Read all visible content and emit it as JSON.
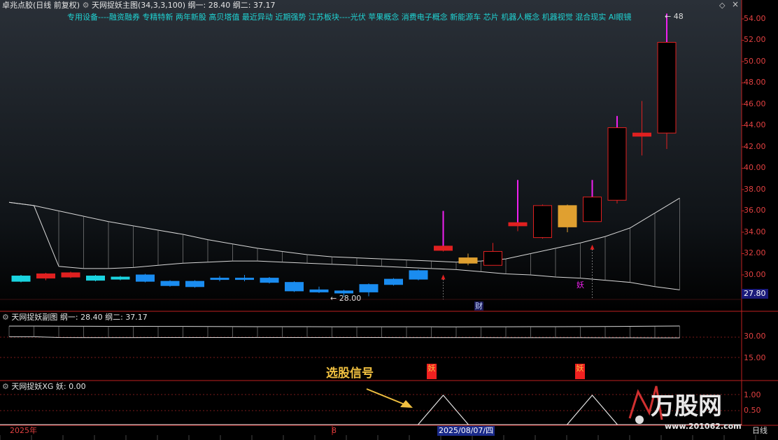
{
  "header": {
    "stock": "卓兆点胶(日线 前复权)",
    "main_indicator": "天网捉妖主图(34,3,3,100)",
    "gang1_label": "纲一:",
    "gang1_value": "28.40",
    "gang2_label": "纲二:",
    "gang2_value": "37.17"
  },
  "concept_tags": "专用设备----融资融券 专精特新 两年新股 高贝塔值 最近异动 近期强势 江苏板块----光伏 苹果概念 消费电子概念 新能源车 芯片 机器人概念 机器视觉 混合现实 AI眼镜",
  "sub1": {
    "title": "天网捉妖副图",
    "gang1_label": "纲一:",
    "gang1_value": "28.40",
    "gang2_label": "纲二:",
    "gang2_value": "37.17"
  },
  "sub2": {
    "title": "天网捉妖XG",
    "yao_label": "妖:",
    "yao_value": "0.00"
  },
  "annotations": {
    "signal_text": "选股信号",
    "low_price": "28.00",
    "high_price": "48",
    "cai": "财",
    "yao_char": "妖",
    "flag1": "妖",
    "flag2": "妖"
  },
  "price_axis": [
    "54.00",
    "52.00",
    "50.00",
    "48.00",
    "46.00",
    "44.00",
    "42.00",
    "40.00",
    "38.00",
    "36.00",
    "34.00",
    "32.00",
    "30.00"
  ],
  "current_price": "27.80",
  "sub1_axis": [
    "30.00",
    "15.00"
  ],
  "sub2_axis": [
    "1.00",
    "0.50"
  ],
  "bottom_bar": {
    "year": "2025年",
    "month": "8",
    "date": "2025/08/07/四",
    "period": "日线"
  },
  "watermark": {
    "brand": "万股网",
    "url": "www.201062.com"
  },
  "colors": {
    "up": "#e02020",
    "down_cyan": "#1ad4e0",
    "down_blue": "#1a8cf0",
    "gold": "#e0a030",
    "magenta": "#f020f0",
    "axis": "#c02020"
  },
  "chart_data": {
    "type": "candlestick",
    "candles": [
      {
        "o": 29.9,
        "c": 29.4,
        "h": 30.0,
        "l": 29.3,
        "color": "cyan"
      },
      {
        "o": 29.7,
        "c": 30.1,
        "h": 30.2,
        "l": 29.5,
        "color": "up"
      },
      {
        "o": 29.8,
        "c": 30.2,
        "h": 30.3,
        "l": 29.7,
        "color": "up"
      },
      {
        "o": 29.9,
        "c": 29.5,
        "h": 30.0,
        "l": 29.4,
        "color": "cyan"
      },
      {
        "o": 29.8,
        "c": 29.6,
        "h": 29.9,
        "l": 29.5,
        "color": "cyan_doji"
      },
      {
        "o": 30.0,
        "c": 29.4,
        "h": 30.1,
        "l": 29.3,
        "color": "blue"
      },
      {
        "o": 29.4,
        "c": 29.0,
        "h": 29.5,
        "l": 28.9,
        "color": "blue"
      },
      {
        "o": 29.4,
        "c": 28.9,
        "h": 29.5,
        "l": 28.8,
        "color": "blue"
      },
      {
        "o": 29.7,
        "c": 29.6,
        "h": 29.9,
        "l": 29.4,
        "color": "blue_doji"
      },
      {
        "o": 29.7,
        "c": 29.6,
        "h": 30.0,
        "l": 29.4,
        "color": "blue_doji"
      },
      {
        "o": 29.7,
        "c": 29.3,
        "h": 29.8,
        "l": 29.2,
        "color": "blue"
      },
      {
        "o": 29.3,
        "c": 28.5,
        "h": 29.4,
        "l": 28.4,
        "color": "blue"
      },
      {
        "o": 28.6,
        "c": 28.4,
        "h": 28.9,
        "l": 28.3,
        "color": "blue"
      },
      {
        "o": 28.5,
        "c": 28.3,
        "h": 28.6,
        "l": 28.0,
        "color": "blue"
      },
      {
        "o": 29.1,
        "c": 28.4,
        "h": 29.2,
        "l": 28.0,
        "color": "blue"
      },
      {
        "o": 29.6,
        "c": 29.1,
        "h": 29.7,
        "l": 29.0,
        "color": "blue"
      },
      {
        "o": 30.4,
        "c": 29.6,
        "h": 30.5,
        "l": 29.5,
        "color": "blue"
      },
      {
        "o": 32.3,
        "c": 32.7,
        "h": 36.0,
        "l": 32.2,
        "color": "up_mag"
      },
      {
        "o": 31.1,
        "c": 31.6,
        "h": 32.0,
        "l": 30.9,
        "color": "gold"
      },
      {
        "o": 30.9,
        "c": 32.2,
        "h": 33.0,
        "l": 30.9,
        "color": "up_hollow"
      },
      {
        "o": 34.6,
        "c": 34.9,
        "h": 38.9,
        "l": 34.1,
        "color": "up_mag"
      },
      {
        "o": 33.5,
        "c": 36.5,
        "h": 36.6,
        "l": 33.4,
        "color": "up_hollow"
      },
      {
        "o": 34.5,
        "c": 36.5,
        "h": 36.6,
        "l": 34.0,
        "color": "gold"
      },
      {
        "o": 35.0,
        "c": 37.3,
        "h": 38.9,
        "l": 35.0,
        "color": "up_hollow_mag"
      },
      {
        "o": 37.0,
        "c": 43.8,
        "h": 44.9,
        "l": 36.7,
        "color": "up_hollow_mag"
      },
      {
        "o": 43.0,
        "c": 43.3,
        "h": 46.3,
        "l": 41.2,
        "color": "up"
      },
      {
        "o": 43.3,
        "c": 51.8,
        "h": 54.5,
        "l": 41.8,
        "color": "up_hollow_mag"
      }
    ],
    "upper_band": [
      36.8,
      36.5,
      36.0,
      35.5,
      35.0,
      34.6,
      34.2,
      33.8,
      33.3,
      32.9,
      32.5,
      32.2,
      31.9,
      31.7,
      31.6,
      31.5,
      31.4,
      31.3,
      31.2,
      31.3,
      31.5,
      32.0,
      32.5,
      33.0,
      33.6,
      34.4,
      35.8,
      37.2
    ],
    "lower_band": [
      36.8,
      36.5,
      30.8,
      30.6,
      30.6,
      30.7,
      30.9,
      31.1,
      31.2,
      31.3,
      31.3,
      31.2,
      31.1,
      31.0,
      30.9,
      30.8,
      30.7,
      30.6,
      30.5,
      30.3,
      30.1,
      30.0,
      29.8,
      29.7,
      29.5,
      29.3,
      28.9,
      28.6
    ],
    "xg_peaks": [
      17,
      23
    ]
  }
}
